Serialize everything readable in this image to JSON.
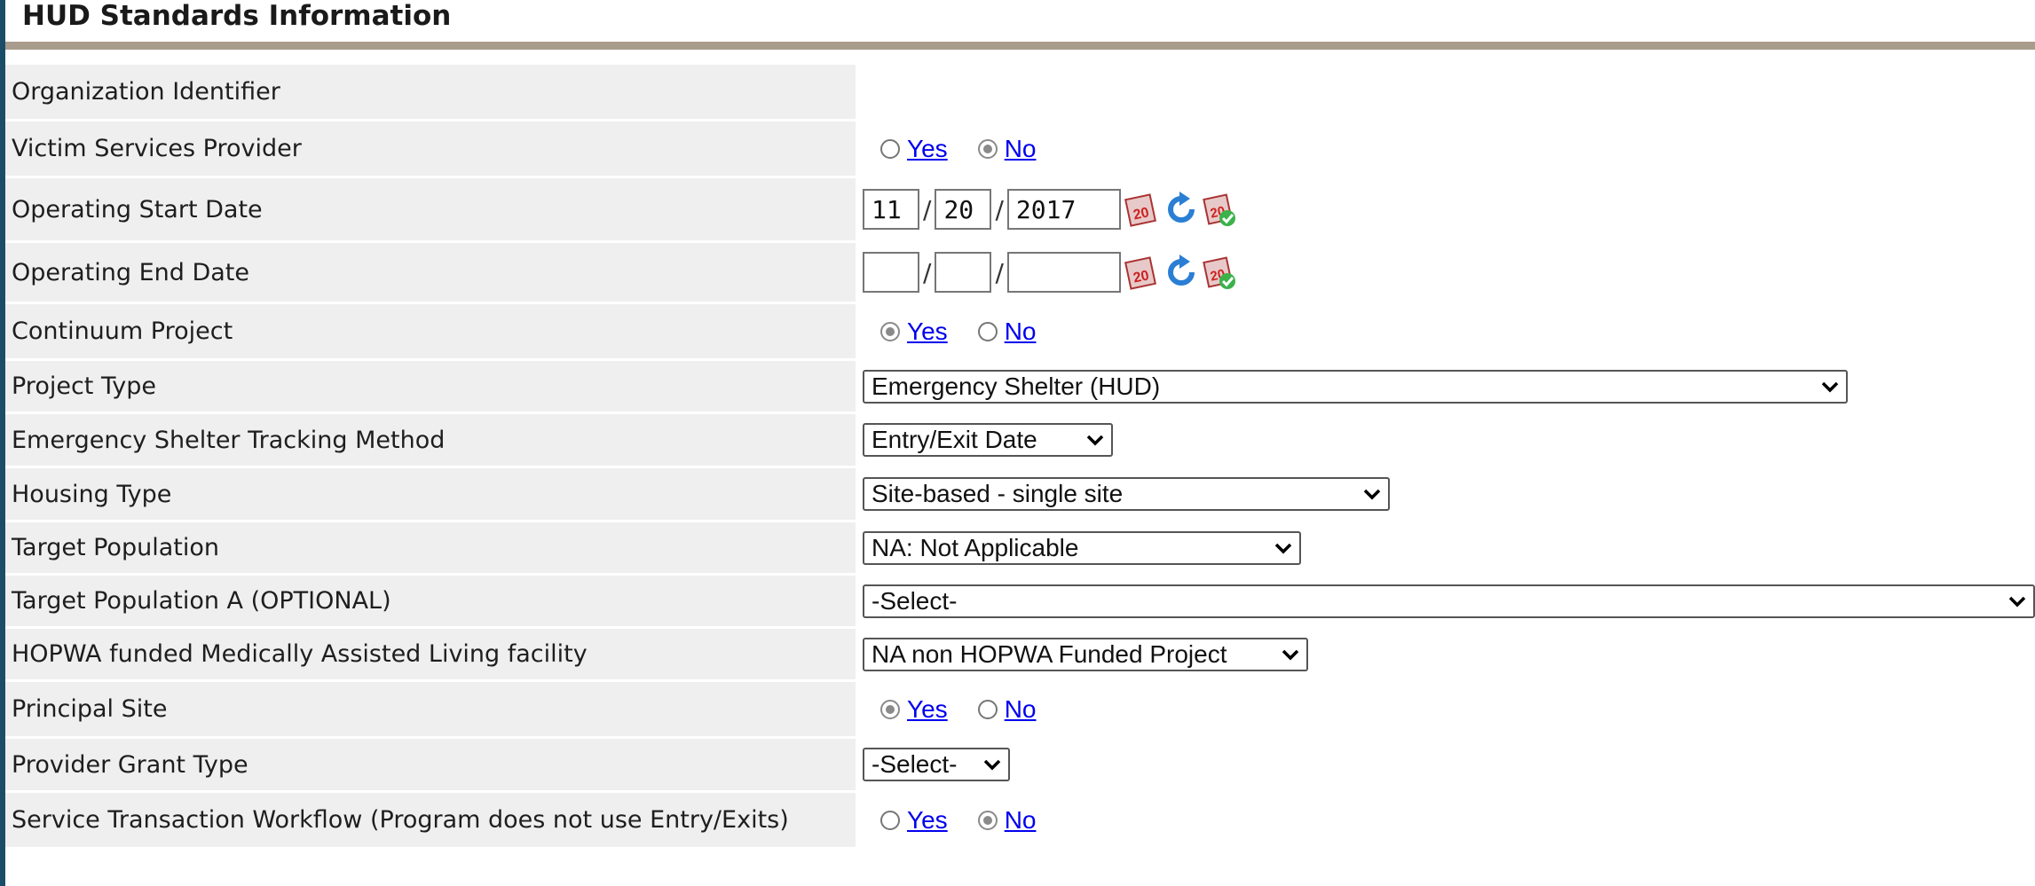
{
  "header": {
    "title": "HUD Standards Information"
  },
  "fields": {
    "org_identifier": {
      "label": "Organization Identifier"
    },
    "victim_services": {
      "label": "Victim Services Provider",
      "yes": "Yes",
      "no": "No",
      "selected": "No"
    },
    "op_start": {
      "label": "Operating Start Date",
      "month": "11",
      "day": "20",
      "year": "2017"
    },
    "op_end": {
      "label": "Operating End Date",
      "month": "",
      "day": "",
      "year": ""
    },
    "continuum": {
      "label": "Continuum Project",
      "yes": "Yes",
      "no": "No",
      "selected": "Yes"
    },
    "project_type": {
      "label": "Project Type",
      "value": "Emergency Shelter (HUD)"
    },
    "es_tracking": {
      "label": "Emergency Shelter Tracking Method",
      "value": "Entry/Exit Date"
    },
    "housing_type": {
      "label": "Housing Type",
      "value": "Site-based - single site"
    },
    "target_pop": {
      "label": "Target Population",
      "value": "NA: Not Applicable"
    },
    "target_pop_a": {
      "label": "Target Population A (OPTIONAL)",
      "value": "-Select-"
    },
    "hopwa": {
      "label": "HOPWA funded Medically Assisted Living facility",
      "value": "NA non HOPWA Funded Project"
    },
    "principal_site": {
      "label": "Principal Site",
      "yes": "Yes",
      "no": "No",
      "selected": "Yes"
    },
    "grant_type": {
      "label": "Provider Grant Type",
      "value": "-Select-"
    },
    "service_workflow": {
      "label": "Service Transaction Workflow (Program does not use Entry/Exits)",
      "yes": "Yes",
      "no": "No",
      "selected": "No"
    }
  },
  "colors": {
    "link": "#0000ee",
    "label_bg": "#efefef",
    "header_rule": "#a89c8c",
    "frame": "#1a4d68"
  },
  "icons": [
    "calendar-icon",
    "refresh-icon",
    "calendar-check-icon",
    "chevron-down-icon"
  ]
}
